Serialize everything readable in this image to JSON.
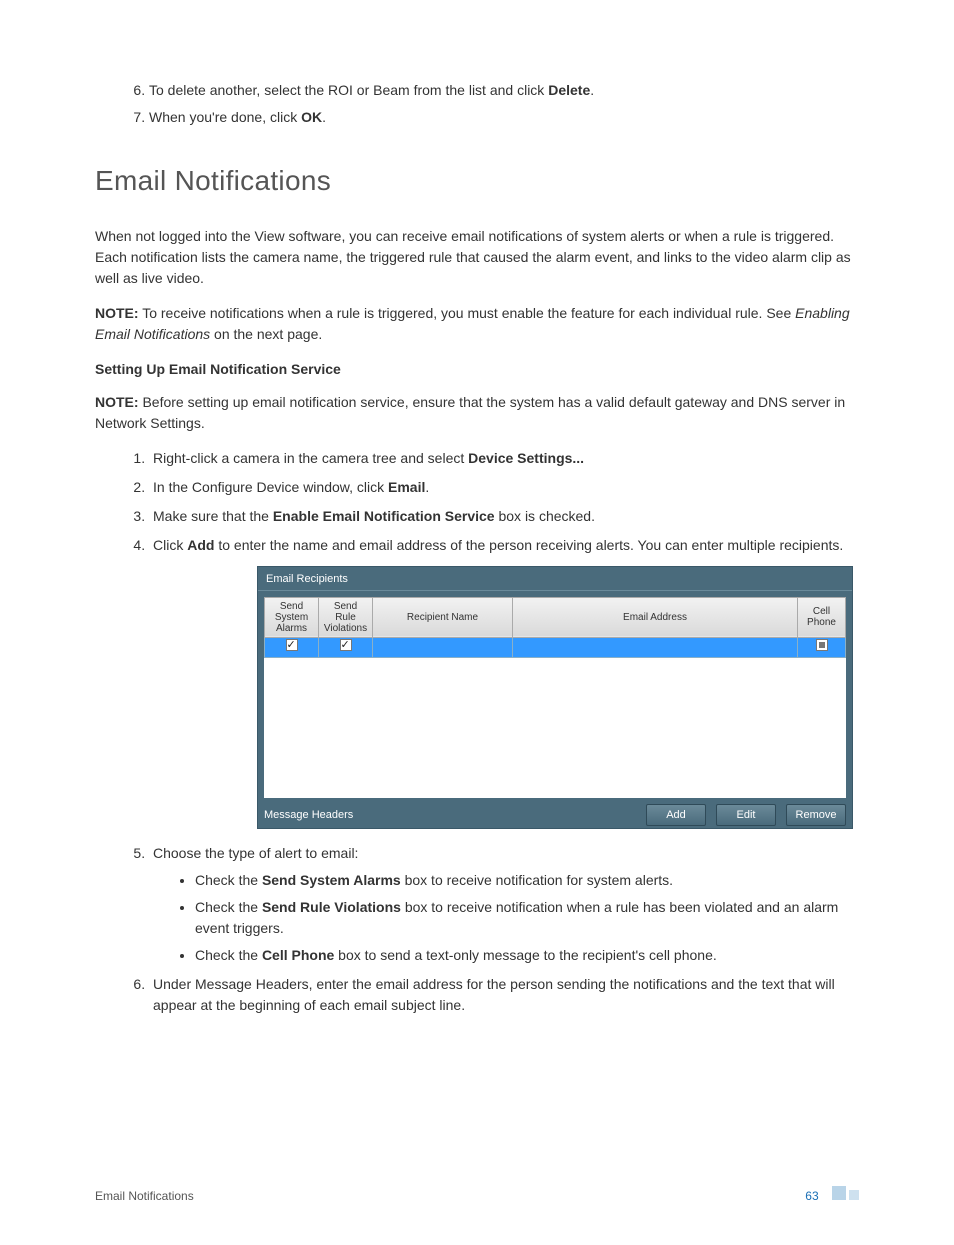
{
  "top_steps": {
    "s6_pre": "To delete another, select the ROI or Beam from the list and click ",
    "s6_bold": "Delete",
    "s6_post": ".",
    "s7_pre": "When you're done, click ",
    "s7_bold": "OK",
    "s7_post": "."
  },
  "heading": "Email Notifications",
  "para1": "When not logged into the View software, you can receive email notifications of system alerts or when a rule is triggered. Each notification lists the camera name, the triggered rule that caused the alarm event, and links to the video alarm clip as well as live video.",
  "note1": {
    "label": "NOTE:",
    "text": " To receive notifications when a rule is triggered, you must enable the feature for each individual rule. See ",
    "italic": "Enabling Email Notifications",
    "tail": " on the next page."
  },
  "subhead": "Setting Up Email Notification Service",
  "note2": {
    "label": "NOTE:",
    "text": " Before setting up email notification service, ensure that the system has a valid default gateway and DNS server in Network Settings."
  },
  "steps": {
    "s1_pre": "Right-click a camera in the camera tree and select ",
    "s1_bold": "Device Settings...",
    "s2_pre": "In the Configure Device window, click ",
    "s2_bold": "Email",
    "s2_post": ".",
    "s3_pre": "Make sure that the ",
    "s3_bold": "Enable Email Notification Service",
    "s3_post": " box is checked.",
    "s4_pre": "Click ",
    "s4_bold": "Add",
    "s4_post": " to enter the name and email address of the person receiving alerts. You can enter multiple recipients.",
    "s5": "Choose the type of alert to email:",
    "s5a_pre": "Check the ",
    "s5a_bold": "Send System Alarms",
    "s5a_post": " box to receive notification for system alerts.",
    "s5b_pre": "Check the ",
    "s5b_bold": "Send Rule Violations",
    "s5b_post": " box to receive notification when a rule has been violated and an alarm event triggers.",
    "s5c_pre": "Check the ",
    "s5c_bold": "Cell Phone",
    "s5c_post": " box to send a text-only message to the recipient's cell phone.",
    "s6": "Under Message Headers, enter the email address for the person sending the notifications and the text that will appear at the beginning of each email subject line."
  },
  "screenshot": {
    "title": "Email Recipients",
    "cols": {
      "c1": "Send System Alarms",
      "c2": "Send Rule Violations",
      "c3": "Recipient Name",
      "c4": "Email Address",
      "c5": "Cell Phone"
    },
    "footer_label": "Message Headers",
    "buttons": {
      "add": "Add",
      "edit": "Edit",
      "remove": "Remove"
    }
  },
  "footer": {
    "left": "Email Notifications",
    "page": "63"
  }
}
